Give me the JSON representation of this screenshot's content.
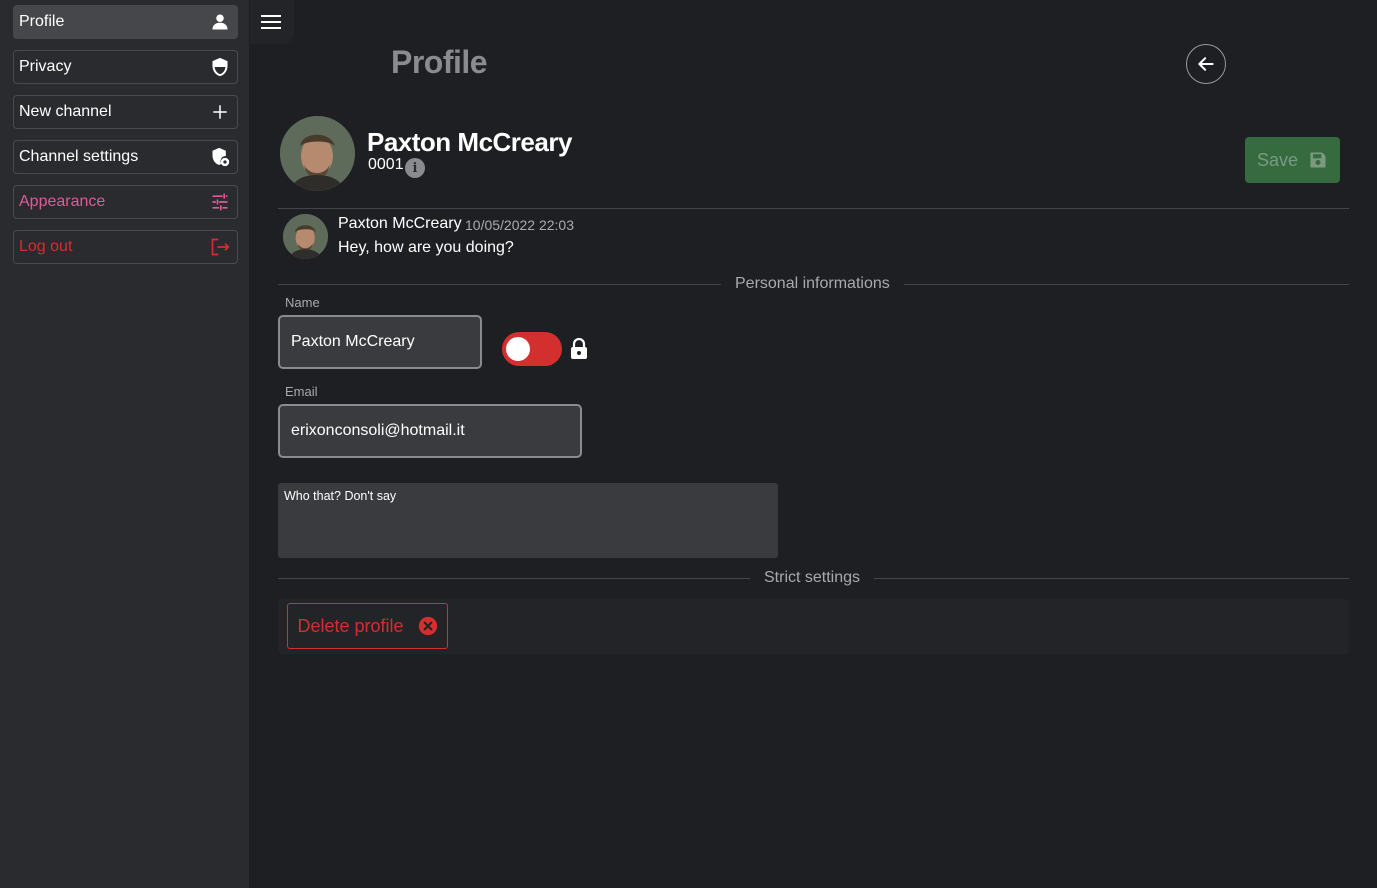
{
  "sidebar": {
    "items": [
      {
        "label": "Profile",
        "icon": "person-icon"
      },
      {
        "label": "Privacy",
        "icon": "shield-icon"
      },
      {
        "label": "New channel",
        "icon": "plus-icon"
      },
      {
        "label": "Channel settings",
        "icon": "shield-settings-icon"
      },
      {
        "label": "Appearance",
        "icon": "sliders-icon"
      },
      {
        "label": "Log out",
        "icon": "logout-icon"
      }
    ]
  },
  "header": {
    "title": "Profile"
  },
  "user": {
    "name": "Paxton McCreary",
    "id": "0001",
    "save_label": "Save"
  },
  "message": {
    "author": "Paxton McCreary",
    "time": "10/05/2022 22:03",
    "text": "Hey, how are you doing?"
  },
  "personal": {
    "section_label": "Personal informations",
    "name_label": "Name",
    "name_value": "Paxton McCreary",
    "email_label": "Email",
    "email_value": "erixonconsoli@hotmail.it",
    "bio": "Who that? Don't say"
  },
  "strict": {
    "section_label": "Strict settings",
    "delete_label": "Delete profile"
  },
  "colors": {
    "accent_pink": "#e3589a",
    "danger_red": "#d32f2f",
    "save_green": "#356b3f"
  }
}
